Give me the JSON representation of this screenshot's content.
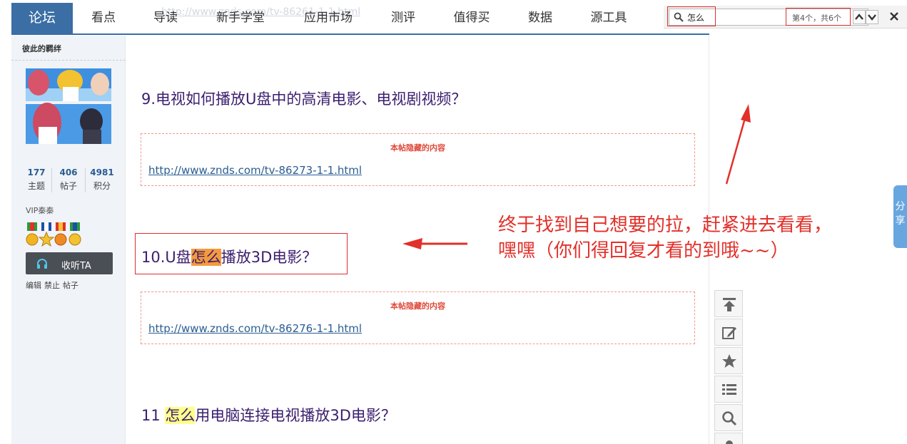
{
  "nav": {
    "items": [
      "论坛",
      "看点",
      "导读",
      "新手学堂",
      "应用市场",
      "测评",
      "值得买",
      "数据",
      "源工具"
    ],
    "ghost_url": "http://www.znds.com/tv-86261-1-1.html"
  },
  "find_bar": {
    "query": "怎么",
    "count": "第4个，共6个"
  },
  "sidebar": {
    "username": "彼此的羁绊",
    "stats": [
      {
        "value": "177",
        "label": "主题"
      },
      {
        "value": "406",
        "label": "帖子"
      },
      {
        "value": "4981",
        "label": "积分"
      }
    ],
    "vip_label": "VIP秦秦",
    "listen_label": "收听TA",
    "admin_links": [
      "编辑",
      "禁止",
      "帖子"
    ]
  },
  "content": {
    "heading9": "9.电视如何播放U盘中的高清电影、电视剧视频？",
    "hidden_title": "本帖隐藏的内容",
    "link1": "http://www.znds.com/tv-86273-1-1.html",
    "heading10_pre": "10.U盘",
    "heading10_hl": "怎么",
    "heading10_post": "播放3D电影？",
    "link2": "http://www.znds.com/tv-86276-1-1.html",
    "heading11_pre": "11 ",
    "heading11_hl": "怎么",
    "heading11_post": "用电脑连接电视播放3D电影？"
  },
  "annotation": {
    "line1": "终于找到自己想要的拉，赶紧进去看看，",
    "line2": "嘿嘿（你们得回复才看的到哦~~）"
  },
  "share_tab": {
    "line1": "分",
    "line2": "享"
  },
  "colors": {
    "nav_active": "#3a6ea5",
    "heading": "#3b1e6e",
    "link": "#2a5d93",
    "annotation": "#e2302a",
    "current_match": "#f59a3c",
    "other_match": "#ffff8c"
  },
  "icons": [
    "search-icon",
    "chevron-up-icon",
    "chevron-down-icon",
    "close-icon",
    "headphones-icon",
    "to-top-icon",
    "edit-icon",
    "star-icon",
    "list-icon",
    "magnifier-icon",
    "user-icon"
  ]
}
